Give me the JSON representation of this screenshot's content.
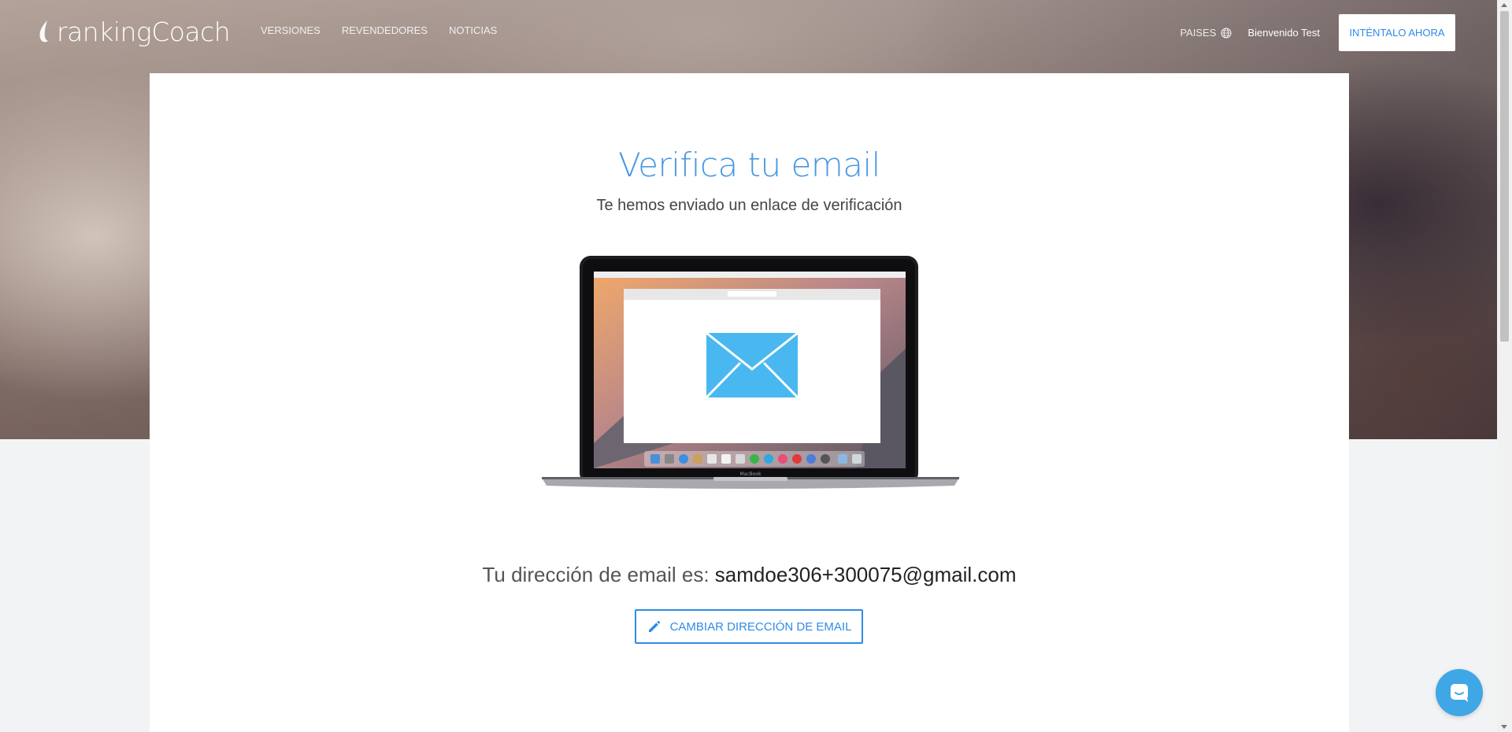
{
  "header": {
    "logo_text": "rankingCoach",
    "nav": [
      "VERSIONES",
      "REVENDEDORES",
      "NOTICIAS"
    ],
    "countries_label": "PAISES",
    "welcome": "Bienvenido Test",
    "cta_label": "INTÉNTALO AHORA"
  },
  "main": {
    "title": "Verifica tu email",
    "subtitle": "Te hemos enviado un enlace de verificación",
    "email_prefix": "Tu dirección de email es:",
    "email_value": "samdoe306+300075@gmail.com",
    "change_button": "CAMBIAR DIRECCIÓN DE EMAIL",
    "laptop_brand": "MacBook"
  },
  "colors": {
    "accent": "#2f8be6",
    "title": "#4a98e0",
    "envelope": "#4ab8f0",
    "chat": "#3fa7e6"
  },
  "icons": [
    "globe-icon",
    "pencil-icon",
    "envelope-icon",
    "chat-icon"
  ]
}
